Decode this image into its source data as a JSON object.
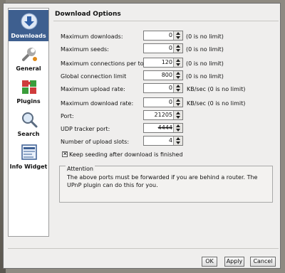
{
  "sidebar": {
    "items": [
      {
        "label": "Downloads",
        "icon": "download-icon"
      },
      {
        "label": "General",
        "icon": "wrench-icon"
      },
      {
        "label": "Plugins",
        "icon": "puzzle-icon"
      },
      {
        "label": "Search",
        "icon": "magnifier-icon"
      },
      {
        "label": "Info Widget",
        "icon": "info-widget-icon"
      }
    ]
  },
  "section_title": "Download Options",
  "settings": [
    {
      "label": "Maximum downloads:",
      "value": "0",
      "hint": "(0 is no limit)"
    },
    {
      "label": "Maximum seeds:",
      "value": "0",
      "hint": "(0 is no limit)"
    },
    {
      "label": "Maximum connections per torrent:",
      "value": "120",
      "hint": "(0 is no limit)"
    },
    {
      "label": "Global connection limit",
      "value": "800",
      "hint": "(0 is no limit)"
    },
    {
      "label": "Maximum upload rate:",
      "value": "0",
      "hint": "KB/sec (0 is no limit)"
    },
    {
      "label": "Maximum download rate:",
      "value": "0",
      "hint": "KB/sec (0 is no limit)"
    },
    {
      "label": "Port:",
      "value": "21205",
      "hint": ""
    },
    {
      "label": "UDP tracker port:",
      "value": "4444",
      "hint": ""
    },
    {
      "label": "Number of upload slots:",
      "value": "4",
      "hint": ""
    }
  ],
  "keep_seeding": {
    "label": "Keep seeding after download is finished",
    "checked": true
  },
  "attention": {
    "title": "Attention",
    "text": "The above ports must be forwarded if you are behind a router. The UPnP plugin can do this for you."
  },
  "buttons": {
    "ok": "OK",
    "apply": "Apply",
    "cancel": "Cancel"
  },
  "colors": {
    "selected": "#3e5f8f",
    "window_bg": "#efeeed"
  }
}
